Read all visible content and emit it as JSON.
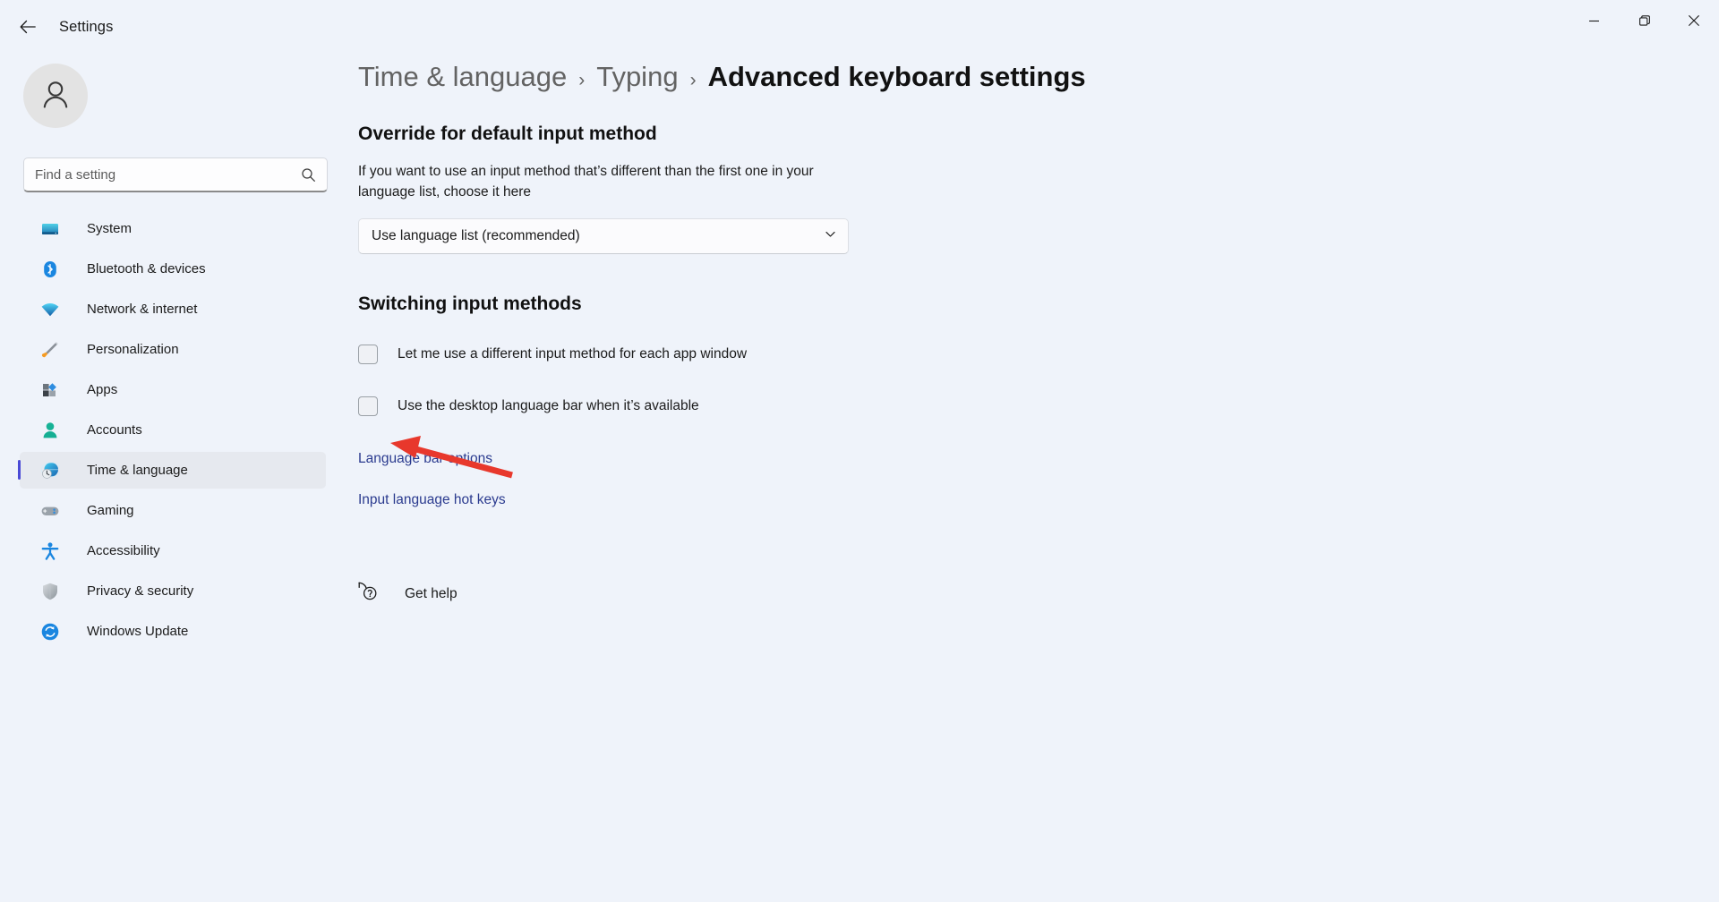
{
  "window": {
    "title": "Settings",
    "back_icon": "back-arrow-icon",
    "minimize_label": "Minimize",
    "maximize_label": "Maximize",
    "close_label": "Close"
  },
  "sidebar": {
    "avatar_icon": "user-avatar-icon",
    "search": {
      "placeholder": "Find a setting",
      "value": "",
      "icon": "search-icon"
    },
    "items": [
      {
        "label": "System",
        "icon": "system-monitor-icon",
        "selected": false
      },
      {
        "label": "Bluetooth & devices",
        "icon": "bluetooth-icon",
        "selected": false
      },
      {
        "label": "Network & internet",
        "icon": "wifi-icon",
        "selected": false
      },
      {
        "label": "Personalization",
        "icon": "paintbrush-icon",
        "selected": false
      },
      {
        "label": "Apps",
        "icon": "apps-grid-icon",
        "selected": false
      },
      {
        "label": "Accounts",
        "icon": "person-icon",
        "selected": false
      },
      {
        "label": "Time & language",
        "icon": "globe-clock-icon",
        "selected": true
      },
      {
        "label": "Gaming",
        "icon": "gamepad-icon",
        "selected": false
      },
      {
        "label": "Accessibility",
        "icon": "accessibility-person-icon",
        "selected": false
      },
      {
        "label": "Privacy & security",
        "icon": "shield-icon",
        "selected": false
      },
      {
        "label": "Windows Update",
        "icon": "refresh-sync-icon",
        "selected": false
      }
    ]
  },
  "main": {
    "breadcrumb": {
      "parts": [
        "Time & language",
        "Typing"
      ],
      "separator": "›",
      "current": "Advanced keyboard settings"
    },
    "override_section": {
      "title": "Override for default input method",
      "description": "If you want to use an input method that’s different than the first one in your language list, choose it here",
      "dropdown": {
        "value": "Use language list (recommended)",
        "chevron_icon": "chevron-down-icon"
      }
    },
    "switching_section": {
      "title": "Switching input methods",
      "checkboxes": [
        {
          "label": "Let me use a different input method for each app window",
          "checked": false
        },
        {
          "label": "Use the desktop language bar when it’s available",
          "checked": false
        }
      ],
      "links": [
        "Language bar options",
        "Input language hot keys"
      ]
    },
    "get_help": {
      "label": "Get help",
      "icon": "help-question-icon"
    }
  },
  "annotation": {
    "type": "arrow",
    "color": "#e8382c",
    "points_to": "use-desktop-language-bar-checkbox"
  },
  "colors": {
    "background": "#eff3fa",
    "accent": "#4a4ad6",
    "link": "#2b3b8f",
    "selected_row": "#e6e9ef",
    "annotation_red": "#e8382c"
  }
}
